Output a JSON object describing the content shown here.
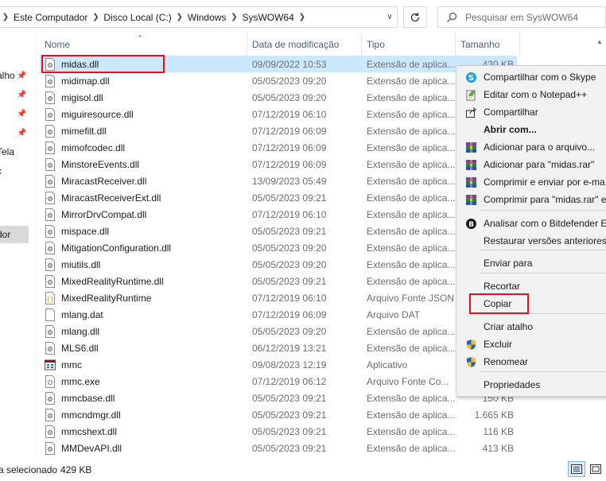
{
  "address": {
    "crumbs": [
      "Este Computador",
      "Disco Local (C:)",
      "Windows",
      "SysWOW64"
    ],
    "search_placeholder": "Pesquisar em SysWOW64"
  },
  "nav": {
    "items": [
      {
        "label": "alho",
        "pinned": true
      },
      {
        "label": "",
        "pinned": true
      },
      {
        "label": "",
        "pinned": true
      },
      {
        "label": "",
        "pinned": true
      },
      {
        "label": "Tela",
        "pinned": false
      },
      {
        "label": "c",
        "pinned": false
      },
      {
        "label": "dor",
        "pinned": false,
        "selected": true
      }
    ]
  },
  "columns": {
    "name": "Nome",
    "date": "Data de modificação",
    "type": "Tipo",
    "size": "Tamanho"
  },
  "files": [
    {
      "name": "midas.dll",
      "date": "09/09/2022 10:53",
      "type": "Extensão de aplica...",
      "size": "430 KB",
      "icon": "dll-icon",
      "selected": true
    },
    {
      "name": "midimap.dll",
      "date": "05/05/2023 09:20",
      "type": "Extensão de aplica...",
      "size": "",
      "icon": "dll-icon"
    },
    {
      "name": "migisol.dll",
      "date": "05/05/2023 09:20",
      "type": "Extensão de aplica...",
      "size": "",
      "icon": "dll-icon"
    },
    {
      "name": "miguiresource.dll",
      "date": "07/12/2019 06:10",
      "type": "Extensão de aplica...",
      "size": "",
      "icon": "dll-icon"
    },
    {
      "name": "mimefilt.dll",
      "date": "07/12/2019 06:09",
      "type": "Extensão de aplica...",
      "size": "",
      "icon": "dll-icon"
    },
    {
      "name": "mimofcodec.dll",
      "date": "07/12/2019 06:09",
      "type": "Extensão de aplica...",
      "size": "",
      "icon": "dll-icon"
    },
    {
      "name": "MinstoreEvents.dll",
      "date": "07/12/2019 06:09",
      "type": "Extensão de aplica...",
      "size": "",
      "icon": "dll-icon"
    },
    {
      "name": "MiracastReceiver.dll",
      "date": "13/09/2023 05:49",
      "type": "Extensão de aplica...",
      "size": "",
      "icon": "dll-icon"
    },
    {
      "name": "MiracastReceiverExt.dll",
      "date": "05/05/2023 09:21",
      "type": "Extensão de aplica...",
      "size": "",
      "icon": "dll-icon"
    },
    {
      "name": "MirrorDrvCompat.dll",
      "date": "07/12/2019 06:10",
      "type": "Extensão de aplica...",
      "size": "",
      "icon": "dll-icon"
    },
    {
      "name": "mispace.dll",
      "date": "05/05/2023 09:21",
      "type": "Extensão de aplica...",
      "size": "",
      "icon": "dll-icon"
    },
    {
      "name": "MitigationConfiguration.dll",
      "date": "05/05/2023 09:20",
      "type": "Extensão de aplica...",
      "size": "",
      "icon": "dll-icon"
    },
    {
      "name": "miutils.dll",
      "date": "05/05/2023 09:20",
      "type": "Extensão de aplica...",
      "size": "",
      "icon": "dll-icon"
    },
    {
      "name": "MixedRealityRuntime.dll",
      "date": "05/05/2023 09:21",
      "type": "Extensão de aplica...",
      "size": "",
      "icon": "dll-icon"
    },
    {
      "name": "MixedRealityRuntime",
      "date": "07/12/2019 06:10",
      "type": "Arquivo Fonte JSON",
      "size": "",
      "icon": "json-icon"
    },
    {
      "name": "mlang.dat",
      "date": "07/12/2019 06:09",
      "type": "Arquivo DAT",
      "size": "",
      "icon": "file-icon"
    },
    {
      "name": "mlang.dll",
      "date": "05/05/2023 09:20",
      "type": "Extensão de aplica...",
      "size": "",
      "icon": "dll-icon"
    },
    {
      "name": "MLS6.dll",
      "date": "06/12/2019 13:21",
      "type": "Extensão de aplica...",
      "size": "",
      "icon": "dll-icon"
    },
    {
      "name": "mmc",
      "date": "09/08/2023 12:19",
      "type": "Aplicativo",
      "size": "",
      "icon": "app-icon"
    },
    {
      "name": "mmc.exe",
      "date": "07/12/2019 06:12",
      "type": "Arquivo Fonte Co...",
      "size": "",
      "icon": "config-icon"
    },
    {
      "name": "mmcbase.dll",
      "date": "05/05/2023 09:21",
      "type": "Extensão de aplica...",
      "size": "150 KB",
      "icon": "dll-icon"
    },
    {
      "name": "mmcndmgr.dll",
      "date": "05/05/2023 09:21",
      "type": "Extensão de aplica...",
      "size": "1.665 KB",
      "icon": "dll-icon"
    },
    {
      "name": "mmcshext.dll",
      "date": "05/05/2023 09:21",
      "type": "Extensão de aplica...",
      "size": "116 KB",
      "icon": "dll-icon"
    },
    {
      "name": "MMDevAPI.dll",
      "date": "05/05/2023 09:21",
      "type": "Extensão de aplica...",
      "size": "413 KB",
      "icon": "dll-icon"
    }
  ],
  "context_menu": {
    "items": [
      {
        "label": "Compartilhar com o Skype",
        "icon": "skype-icon",
        "bold": false
      },
      {
        "label": "Editar com o Notepad++",
        "icon": "notepadpp-icon",
        "bold": false
      },
      {
        "label": "Compartilhar",
        "icon": "share-icon",
        "bold": false
      },
      {
        "label": "Abrir com...",
        "icon": "",
        "bold": true
      },
      {
        "label": "Adicionar para o arquivo...",
        "icon": "winrar-icon",
        "bold": false
      },
      {
        "label": "Adicionar para \"midas.rar\"",
        "icon": "winrar-icon",
        "bold": false
      },
      {
        "label": "Comprimir e enviar por e-ma",
        "icon": "winrar-icon",
        "bold": false
      },
      {
        "label": "Comprimir para \"midas.rar\" e",
        "icon": "winrar-icon",
        "bold": false
      },
      {
        "label": "Analisar com o Bitdefender En",
        "icon": "bitdefender-icon",
        "bold": false
      },
      {
        "label": "Restaurar versões anteriores",
        "icon": "",
        "bold": false
      },
      {
        "label": "Enviar para",
        "icon": "",
        "bold": false
      },
      {
        "label": "Recortar",
        "icon": "",
        "bold": false
      },
      {
        "label": "Copiar",
        "icon": "",
        "bold": false
      },
      {
        "label": "Criar atalho",
        "icon": "",
        "bold": false
      },
      {
        "label": "Excluir",
        "icon": "uac-shield-icon",
        "bold": false
      },
      {
        "label": "Renomear",
        "icon": "uac-shield-icon",
        "bold": false
      },
      {
        "label": "Propriedades",
        "icon": "",
        "bold": false
      }
    ]
  },
  "status": {
    "selection": "a selecionado",
    "size": "429 KB"
  },
  "colors": {
    "selection_bg": "#cce8ff",
    "highlight_box": "#e0121c",
    "menu_bg": "#f2f2f2",
    "header_text": "#4c607a"
  }
}
